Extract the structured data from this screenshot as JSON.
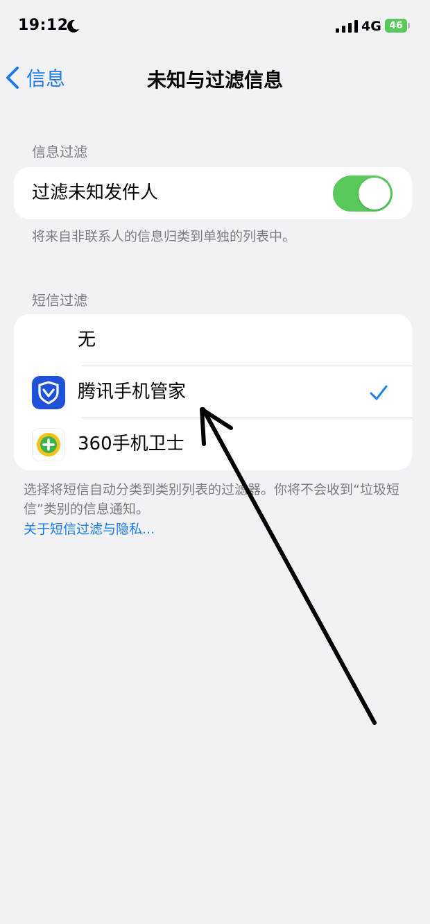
{
  "status_bar": {
    "time": "19:12",
    "network": "4G",
    "battery": "46",
    "moon_icon": "moon-icon",
    "signal_icon": "signal-bars-icon"
  },
  "nav": {
    "back_label": "信息",
    "title": "未知与过滤信息"
  },
  "message_filter": {
    "header": "信息过滤",
    "toggle_label": "过滤未知发件人",
    "toggle_on": true,
    "footnote": "将来自非联系人的信息归类到单独的列表中。"
  },
  "sms_filter": {
    "header": "短信过滤",
    "options": [
      {
        "label": "无",
        "selected": false,
        "icon": ""
      },
      {
        "label": "腾讯手机管家",
        "selected": true,
        "icon": "shield-app-icon"
      },
      {
        "label": "360手机卫士",
        "selected": false,
        "icon": "plus-circle-app-icon"
      }
    ],
    "footer_text": "选择将短信自动分类到类别列表的过滤器。你将不会收到“垃圾短信”类别的信息通知。",
    "footer_link": "关于短信过滤与隐私..."
  },
  "colors": {
    "accent": "#1a7cf5",
    "toggle_on": "#5ac95c",
    "background": "#f1f1f6",
    "secondary_text": "#7c7c81"
  }
}
